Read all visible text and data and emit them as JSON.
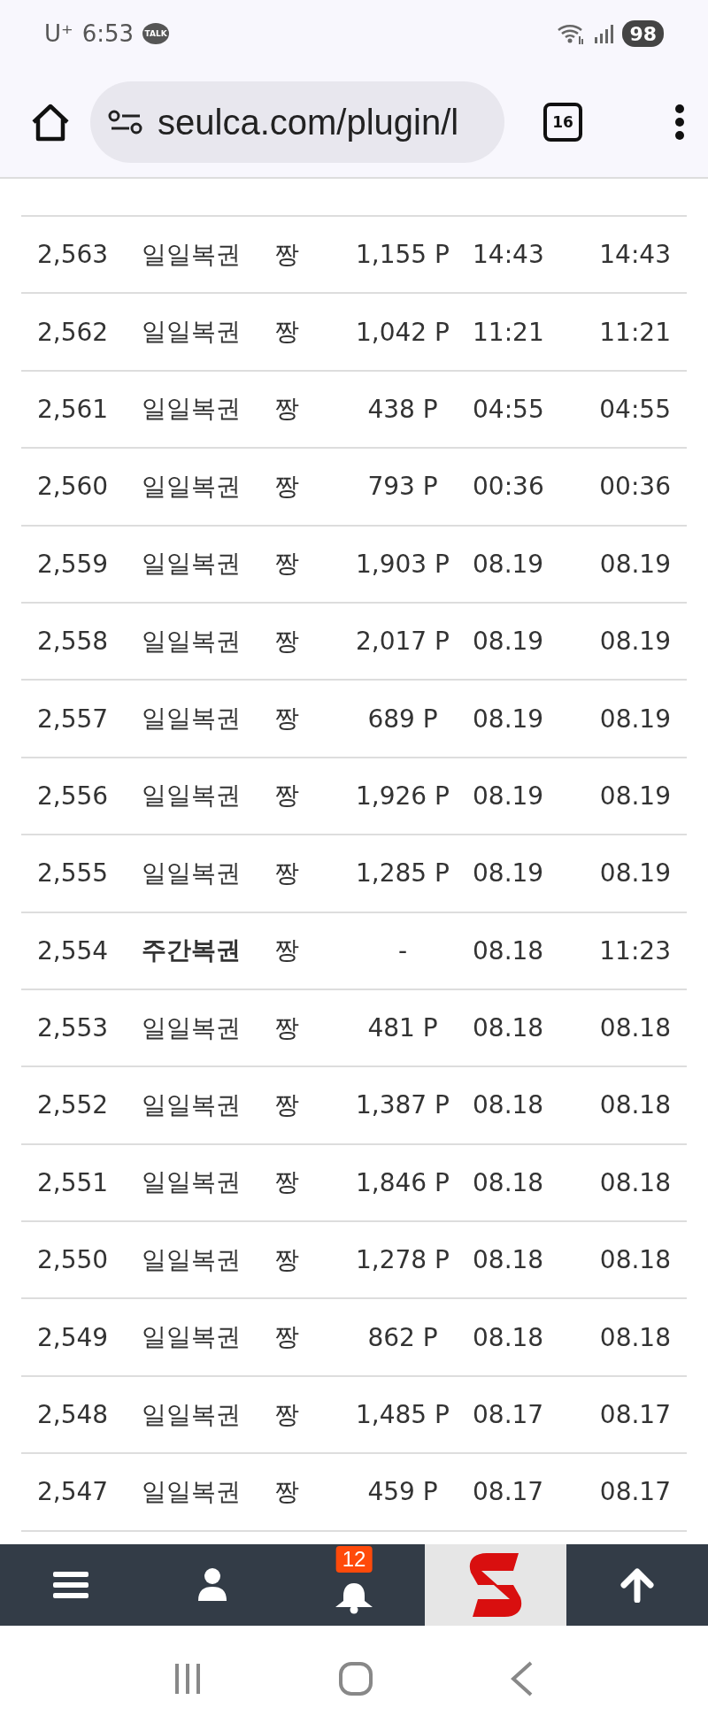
{
  "status_bar": {
    "carrier": "U⁺",
    "time": "6:53",
    "notification": "TALK",
    "battery": "98"
  },
  "browser": {
    "url": "seulca.com/plugin/l",
    "tab_count": "16"
  },
  "table": {
    "rows": [
      {
        "number": "2,563",
        "title": "일일복권",
        "author": "짱",
        "points": "1,155 P",
        "date": "14:43",
        "last": "14:43",
        "emphasized": false
      },
      {
        "number": "2,562",
        "title": "일일복권",
        "author": "짱",
        "points": "1,042 P",
        "date": "11:21",
        "last": "11:21",
        "emphasized": false
      },
      {
        "number": "2,561",
        "title": "일일복권",
        "author": "짱",
        "points": "438 P",
        "date": "04:55",
        "last": "04:55",
        "emphasized": false
      },
      {
        "number": "2,560",
        "title": "일일복권",
        "author": "짱",
        "points": "793 P",
        "date": "00:36",
        "last": "00:36",
        "emphasized": false
      },
      {
        "number": "2,559",
        "title": "일일복권",
        "author": "짱",
        "points": "1,903 P",
        "date": "08.19",
        "last": "08.19",
        "emphasized": false
      },
      {
        "number": "2,558",
        "title": "일일복권",
        "author": "짱",
        "points": "2,017 P",
        "date": "08.19",
        "last": "08.19",
        "emphasized": false
      },
      {
        "number": "2,557",
        "title": "일일복권",
        "author": "짱",
        "points": "689 P",
        "date": "08.19",
        "last": "08.19",
        "emphasized": false
      },
      {
        "number": "2,556",
        "title": "일일복권",
        "author": "짱",
        "points": "1,926 P",
        "date": "08.19",
        "last": "08.19",
        "emphasized": false
      },
      {
        "number": "2,555",
        "title": "일일복권",
        "author": "짱",
        "points": "1,285 P",
        "date": "08.19",
        "last": "08.19",
        "emphasized": false
      },
      {
        "number": "2,554",
        "title": "주간복권",
        "author": "짱",
        "points": "-",
        "date": "08.18",
        "last": "11:23",
        "emphasized": true
      },
      {
        "number": "2,553",
        "title": "일일복권",
        "author": "짱",
        "points": "481 P",
        "date": "08.18",
        "last": "08.18",
        "emphasized": false
      },
      {
        "number": "2,552",
        "title": "일일복권",
        "author": "짱",
        "points": "1,387 P",
        "date": "08.18",
        "last": "08.18",
        "emphasized": false
      },
      {
        "number": "2,551",
        "title": "일일복권",
        "author": "짱",
        "points": "1,846 P",
        "date": "08.18",
        "last": "08.18",
        "emphasized": false
      },
      {
        "number": "2,550",
        "title": "일일복권",
        "author": "짱",
        "points": "1,278 P",
        "date": "08.18",
        "last": "08.18",
        "emphasized": false
      },
      {
        "number": "2,549",
        "title": "일일복권",
        "author": "짱",
        "points": "862 P",
        "date": "08.18",
        "last": "08.18",
        "emphasized": false
      },
      {
        "number": "2,548",
        "title": "일일복권",
        "author": "짱",
        "points": "1,485 P",
        "date": "08.17",
        "last": "08.17",
        "emphasized": false
      },
      {
        "number": "2,547",
        "title": "일일복권",
        "author": "짱",
        "points": "459 P",
        "date": "08.17",
        "last": "08.17",
        "emphasized": false
      }
    ]
  },
  "bottom_bar": {
    "notification_count": "12"
  }
}
